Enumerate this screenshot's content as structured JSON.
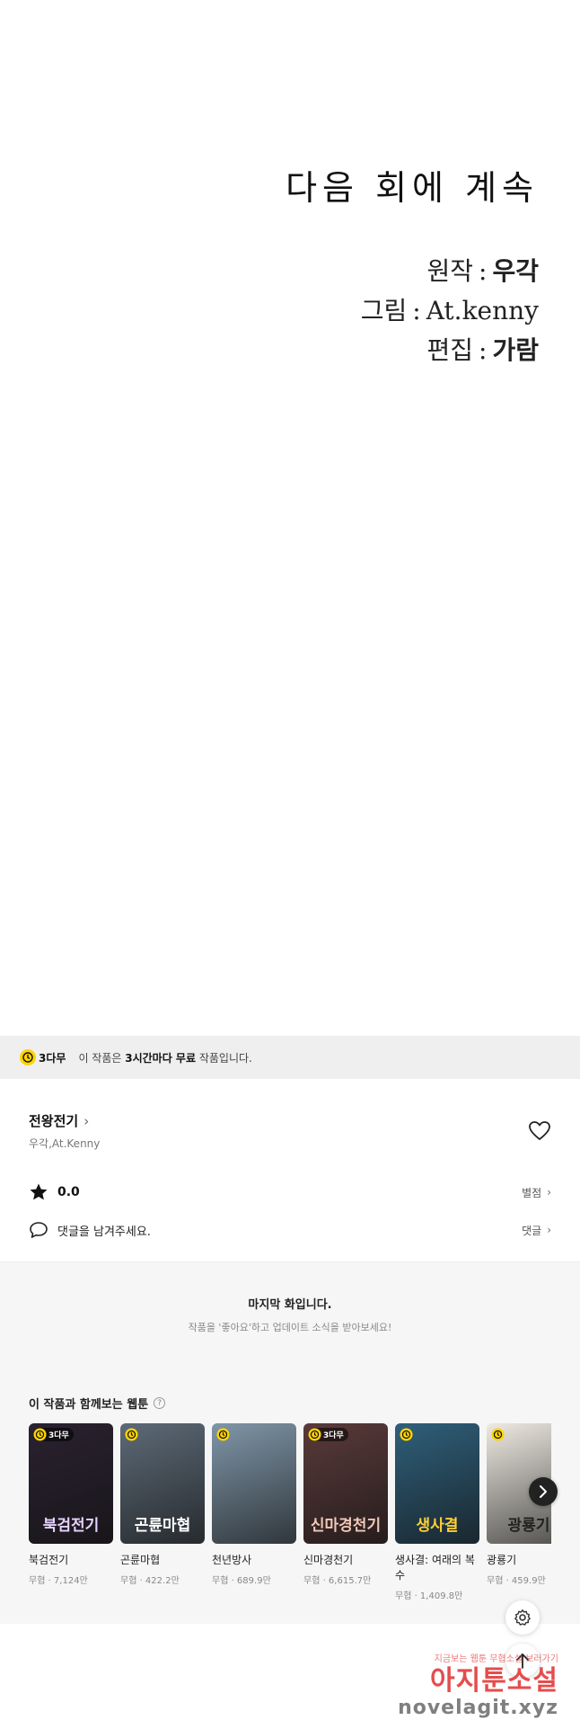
{
  "panel": {
    "title": "다음 회에 계속",
    "credits": [
      {
        "role": "원작",
        "sep": ":",
        "name": "우각"
      },
      {
        "role": "그림",
        "sep": ":",
        "name": "At.kenny"
      },
      {
        "role": "편집",
        "sep": ":",
        "name": "가람"
      }
    ]
  },
  "free_bar": {
    "badge": "3다무",
    "text_pre": "이 작품은 ",
    "text_bold": "3시간마다 무료",
    "text_post": " 작품입니다."
  },
  "series": {
    "title": "전왕전기",
    "authors": "우각,At.Kenny",
    "rating": "0.0",
    "rating_link": "별점",
    "comment_placeholder": "댓글을 남겨주세요.",
    "comment_link": "댓글"
  },
  "last_notice": {
    "title": "마지막 화입니다.",
    "subtitle": "작품을 '좋아요'하고 업데이트 소식을 받아보세요!"
  },
  "recommend": {
    "heading": "이 작품과 함께보는 웹툰",
    "items": [
      {
        "title": "북검전기",
        "meta": "무협 · 7,124만",
        "badge": "3다무",
        "art": "북검전기",
        "bg": "#2a2230",
        "fg": "#e6d2ff"
      },
      {
        "title": "곤륜마협",
        "meta": "무협 · 422.2만",
        "badge": "",
        "art": "곤륜마협",
        "bg": "#5d6a77",
        "fg": "#ffffff"
      },
      {
        "title": "천년방사",
        "meta": "무협 · 689.9만",
        "badge": "",
        "art": "",
        "bg": "#7f96a8",
        "fg": "#ffffff"
      },
      {
        "title": "신마경천기",
        "meta": "무협 · 6,615.7만",
        "badge": "3다무",
        "art": "신마경천기",
        "bg": "#5a3a3a",
        "fg": "#f0c8b8"
      },
      {
        "title": "생사결: 여래의 복수",
        "meta": "무협 · 1,409.8만",
        "badge": "",
        "art": "생사결",
        "bg": "#2f5f7a",
        "fg": "#ffcf3a"
      },
      {
        "title": "광룡기",
        "meta": "무협 · 459.9만",
        "badge": "",
        "art": "광룡기",
        "bg": "#eeeae2",
        "fg": "#222222"
      }
    ]
  },
  "watermark": {
    "small": "지금보는 웹툰 무협소설 보러가기",
    "big": "아지툰소설",
    "url": "novelagit.xyz"
  }
}
